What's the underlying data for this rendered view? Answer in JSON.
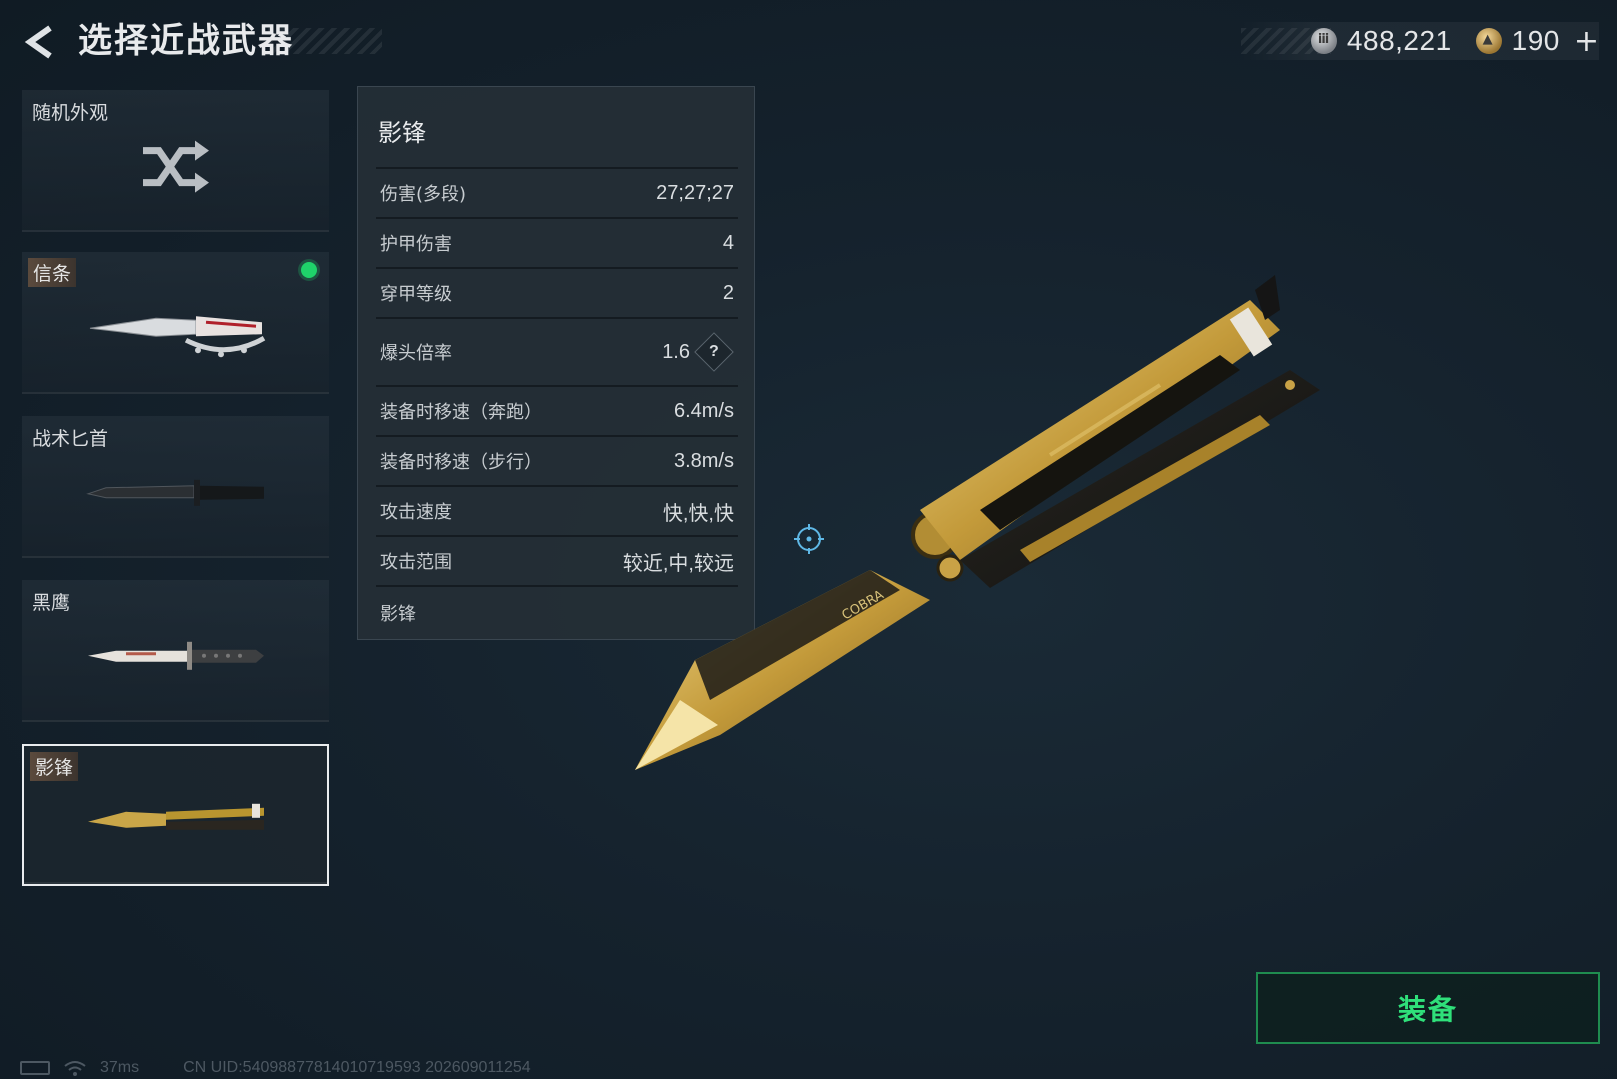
{
  "header": {
    "title": "选择近战武器",
    "currencies": [
      {
        "icon": "silver-coin-icon",
        "value": "488,221"
      },
      {
        "icon": "gold-coin-icon",
        "value": "190"
      }
    ],
    "add_label": "+"
  },
  "weapon_list": [
    {
      "label": "随机外观",
      "type": "random",
      "icon": "shuffle-icon"
    },
    {
      "label": "信条",
      "type": "skin",
      "equipped": true
    },
    {
      "label": "战术匕首",
      "type": "skin"
    },
    {
      "label": "黑鹰",
      "type": "skin"
    },
    {
      "label": "影锋",
      "type": "skin",
      "selected": true
    }
  ],
  "stats": {
    "title": "影锋",
    "rows": [
      {
        "key": "伤害(多段)",
        "value": "27;27;27"
      },
      {
        "key": "护甲伤害",
        "value": "4"
      },
      {
        "key": "穿甲等级",
        "value": "2"
      },
      {
        "key": "爆头倍率",
        "value": "1.6",
        "help": "?"
      },
      {
        "key": "装备时移速（奔跑）",
        "value": "6.4m/s"
      },
      {
        "key": "装备时移速（步行）",
        "value": "3.8m/s"
      },
      {
        "key": "攻击速度",
        "value": "快,快,快"
      },
      {
        "key": "攻击范围",
        "value": "较近,中,较远"
      }
    ],
    "footer_label": "影锋"
  },
  "equip_button": {
    "label": "装备"
  },
  "knife_engraving": "COBRA",
  "footer": {
    "ping": "37ms",
    "uid": "CN UID:540988778140107195​93 202609011254"
  },
  "colors": {
    "accent_green": "#2fe07a",
    "equipped_dot": "#1fd36a",
    "background": "#15222d"
  }
}
